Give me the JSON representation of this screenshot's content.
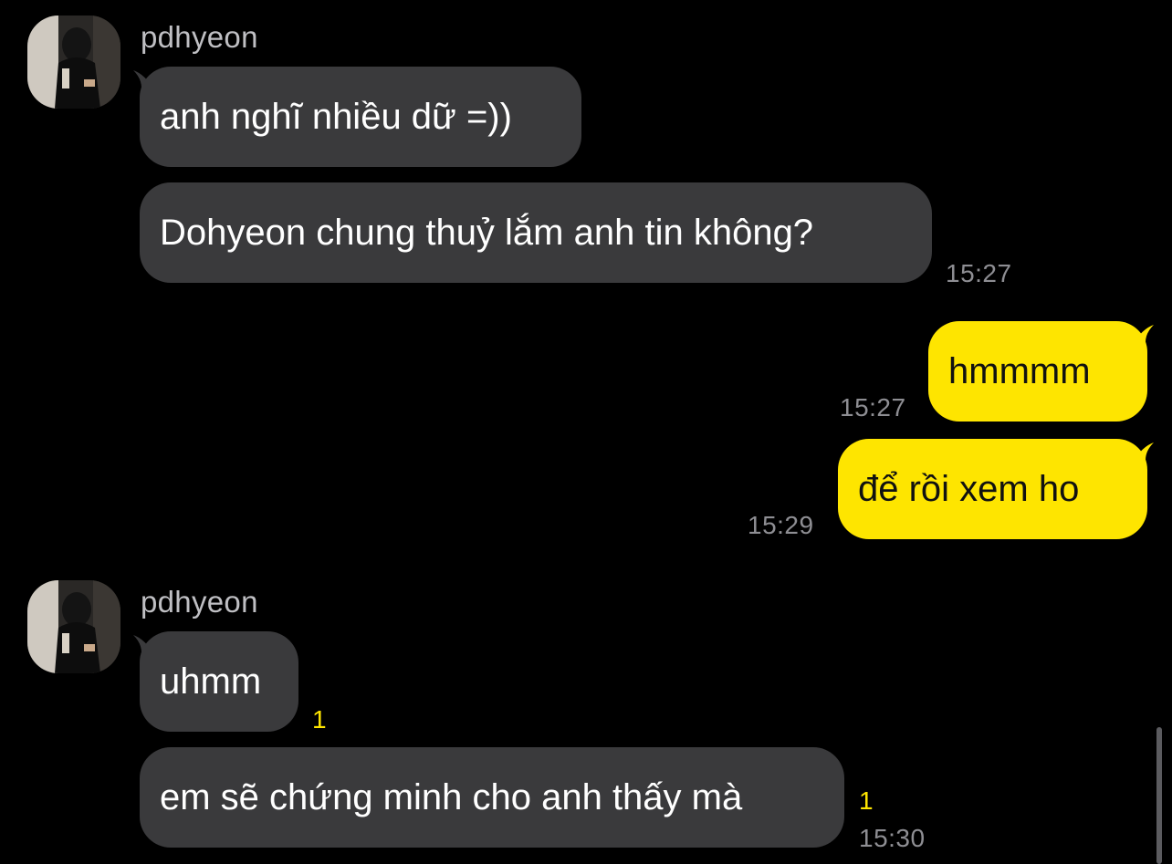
{
  "colors": {
    "background": "#000000",
    "incoming_bubble": "#3a3a3c",
    "outgoing_bubble": "#fee500",
    "timestamp": "#8e8e93",
    "unread_count": "#fee500"
  },
  "groups": [
    {
      "sender": "pdhyeon",
      "avatar_icon": "profile-photo-icon",
      "messages": [
        {
          "text": "anh nghĩ nhiều dữ =))"
        },
        {
          "text": "Dohyeon chung thuỷ lắm anh tin không?",
          "time": "15:27"
        }
      ]
    },
    {
      "sender": "me",
      "messages": [
        {
          "text": "hmmmm",
          "time": "15:27"
        },
        {
          "text": "để rồi xem ho",
          "time": "15:29"
        }
      ]
    },
    {
      "sender": "pdhyeon",
      "avatar_icon": "profile-photo-icon",
      "messages": [
        {
          "text": "uhmm",
          "unread": "1"
        },
        {
          "text": "em sẽ chứng minh cho anh thấy mà",
          "unread": "1",
          "time": "15:30"
        }
      ]
    }
  ]
}
